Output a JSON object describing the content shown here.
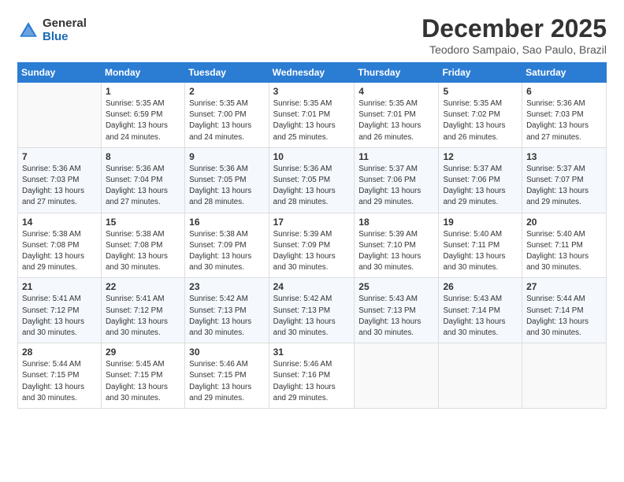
{
  "logo": {
    "general": "General",
    "blue": "Blue"
  },
  "header": {
    "month": "December 2025",
    "location": "Teodoro Sampaio, Sao Paulo, Brazil"
  },
  "weekdays": [
    "Sunday",
    "Monday",
    "Tuesday",
    "Wednesday",
    "Thursday",
    "Friday",
    "Saturday"
  ],
  "weeks": [
    [
      {
        "num": "",
        "sunrise": "",
        "sunset": "",
        "daylight": ""
      },
      {
        "num": "1",
        "sunrise": "Sunrise: 5:35 AM",
        "sunset": "Sunset: 6:59 PM",
        "daylight": "Daylight: 13 hours and 24 minutes."
      },
      {
        "num": "2",
        "sunrise": "Sunrise: 5:35 AM",
        "sunset": "Sunset: 7:00 PM",
        "daylight": "Daylight: 13 hours and 24 minutes."
      },
      {
        "num": "3",
        "sunrise": "Sunrise: 5:35 AM",
        "sunset": "Sunset: 7:01 PM",
        "daylight": "Daylight: 13 hours and 25 minutes."
      },
      {
        "num": "4",
        "sunrise": "Sunrise: 5:35 AM",
        "sunset": "Sunset: 7:01 PM",
        "daylight": "Daylight: 13 hours and 26 minutes."
      },
      {
        "num": "5",
        "sunrise": "Sunrise: 5:35 AM",
        "sunset": "Sunset: 7:02 PM",
        "daylight": "Daylight: 13 hours and 26 minutes."
      },
      {
        "num": "6",
        "sunrise": "Sunrise: 5:36 AM",
        "sunset": "Sunset: 7:03 PM",
        "daylight": "Daylight: 13 hours and 27 minutes."
      }
    ],
    [
      {
        "num": "7",
        "sunrise": "Sunrise: 5:36 AM",
        "sunset": "Sunset: 7:03 PM",
        "daylight": "Daylight: 13 hours and 27 minutes."
      },
      {
        "num": "8",
        "sunrise": "Sunrise: 5:36 AM",
        "sunset": "Sunset: 7:04 PM",
        "daylight": "Daylight: 13 hours and 27 minutes."
      },
      {
        "num": "9",
        "sunrise": "Sunrise: 5:36 AM",
        "sunset": "Sunset: 7:05 PM",
        "daylight": "Daylight: 13 hours and 28 minutes."
      },
      {
        "num": "10",
        "sunrise": "Sunrise: 5:36 AM",
        "sunset": "Sunset: 7:05 PM",
        "daylight": "Daylight: 13 hours and 28 minutes."
      },
      {
        "num": "11",
        "sunrise": "Sunrise: 5:37 AM",
        "sunset": "Sunset: 7:06 PM",
        "daylight": "Daylight: 13 hours and 29 minutes."
      },
      {
        "num": "12",
        "sunrise": "Sunrise: 5:37 AM",
        "sunset": "Sunset: 7:06 PM",
        "daylight": "Daylight: 13 hours and 29 minutes."
      },
      {
        "num": "13",
        "sunrise": "Sunrise: 5:37 AM",
        "sunset": "Sunset: 7:07 PM",
        "daylight": "Daylight: 13 hours and 29 minutes."
      }
    ],
    [
      {
        "num": "14",
        "sunrise": "Sunrise: 5:38 AM",
        "sunset": "Sunset: 7:08 PM",
        "daylight": "Daylight: 13 hours and 29 minutes."
      },
      {
        "num": "15",
        "sunrise": "Sunrise: 5:38 AM",
        "sunset": "Sunset: 7:08 PM",
        "daylight": "Daylight: 13 hours and 30 minutes."
      },
      {
        "num": "16",
        "sunrise": "Sunrise: 5:38 AM",
        "sunset": "Sunset: 7:09 PM",
        "daylight": "Daylight: 13 hours and 30 minutes."
      },
      {
        "num": "17",
        "sunrise": "Sunrise: 5:39 AM",
        "sunset": "Sunset: 7:09 PM",
        "daylight": "Daylight: 13 hours and 30 minutes."
      },
      {
        "num": "18",
        "sunrise": "Sunrise: 5:39 AM",
        "sunset": "Sunset: 7:10 PM",
        "daylight": "Daylight: 13 hours and 30 minutes."
      },
      {
        "num": "19",
        "sunrise": "Sunrise: 5:40 AM",
        "sunset": "Sunset: 7:11 PM",
        "daylight": "Daylight: 13 hours and 30 minutes."
      },
      {
        "num": "20",
        "sunrise": "Sunrise: 5:40 AM",
        "sunset": "Sunset: 7:11 PM",
        "daylight": "Daylight: 13 hours and 30 minutes."
      }
    ],
    [
      {
        "num": "21",
        "sunrise": "Sunrise: 5:41 AM",
        "sunset": "Sunset: 7:12 PM",
        "daylight": "Daylight: 13 hours and 30 minutes."
      },
      {
        "num": "22",
        "sunrise": "Sunrise: 5:41 AM",
        "sunset": "Sunset: 7:12 PM",
        "daylight": "Daylight: 13 hours and 30 minutes."
      },
      {
        "num": "23",
        "sunrise": "Sunrise: 5:42 AM",
        "sunset": "Sunset: 7:13 PM",
        "daylight": "Daylight: 13 hours and 30 minutes."
      },
      {
        "num": "24",
        "sunrise": "Sunrise: 5:42 AM",
        "sunset": "Sunset: 7:13 PM",
        "daylight": "Daylight: 13 hours and 30 minutes."
      },
      {
        "num": "25",
        "sunrise": "Sunrise: 5:43 AM",
        "sunset": "Sunset: 7:13 PM",
        "daylight": "Daylight: 13 hours and 30 minutes."
      },
      {
        "num": "26",
        "sunrise": "Sunrise: 5:43 AM",
        "sunset": "Sunset: 7:14 PM",
        "daylight": "Daylight: 13 hours and 30 minutes."
      },
      {
        "num": "27",
        "sunrise": "Sunrise: 5:44 AM",
        "sunset": "Sunset: 7:14 PM",
        "daylight": "Daylight: 13 hours and 30 minutes."
      }
    ],
    [
      {
        "num": "28",
        "sunrise": "Sunrise: 5:44 AM",
        "sunset": "Sunset: 7:15 PM",
        "daylight": "Daylight: 13 hours and 30 minutes."
      },
      {
        "num": "29",
        "sunrise": "Sunrise: 5:45 AM",
        "sunset": "Sunset: 7:15 PM",
        "daylight": "Daylight: 13 hours and 30 minutes."
      },
      {
        "num": "30",
        "sunrise": "Sunrise: 5:46 AM",
        "sunset": "Sunset: 7:15 PM",
        "daylight": "Daylight: 13 hours and 29 minutes."
      },
      {
        "num": "31",
        "sunrise": "Sunrise: 5:46 AM",
        "sunset": "Sunset: 7:16 PM",
        "daylight": "Daylight: 13 hours and 29 minutes."
      },
      {
        "num": "",
        "sunrise": "",
        "sunset": "",
        "daylight": ""
      },
      {
        "num": "",
        "sunrise": "",
        "sunset": "",
        "daylight": ""
      },
      {
        "num": "",
        "sunrise": "",
        "sunset": "",
        "daylight": ""
      }
    ]
  ]
}
